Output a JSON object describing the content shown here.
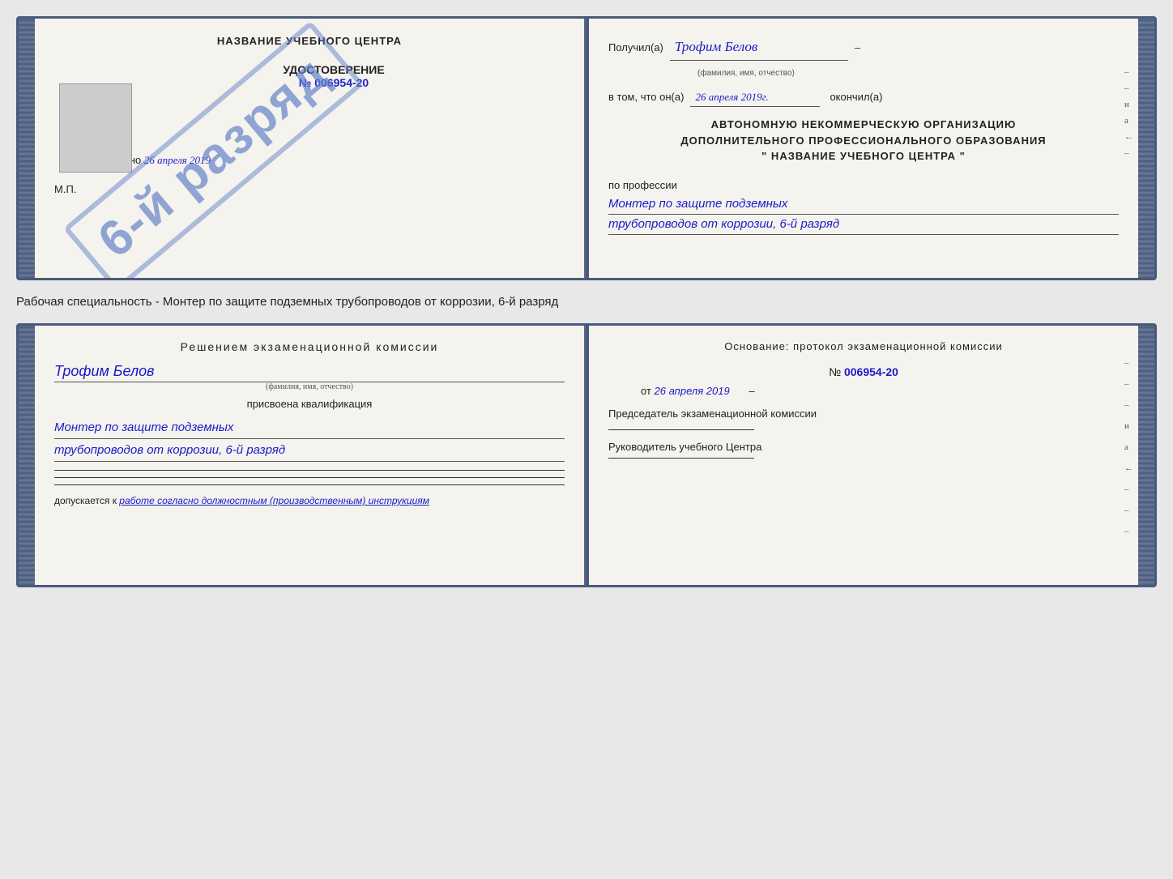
{
  "upper_cert": {
    "left": {
      "header": "НАЗВАНИЕ УЧЕБНОГО ЦЕНТРА",
      "placeholder_box": true,
      "udost_title": "УДОСТОВЕРЕНИЕ",
      "udost_num_prefix": "№",
      "udost_num": "006954-20",
      "vydano_label": "Выдано",
      "vydano_date": "26 апреля 2019",
      "mp_label": "М.П.",
      "stamp_text": "6-й разряд"
    },
    "right": {
      "poluchil_label": "Получил(а)",
      "poluchil_value": "Трофим Белов",
      "poluchil_sub": "(фамилия, имя, отчество)",
      "vtom_label": "в том, что он(а)",
      "vtom_date": "26 апреля 2019г.",
      "okochil_label": "окончил(а)",
      "org_line1": "АВТОНОМНУЮ НЕКОММЕРЧЕСКУЮ ОРГАНИЗАЦИЮ",
      "org_line2": "ДОПОЛНИТЕЛЬНОГО ПРОФЕССИОНАЛЬНОГО ОБРАЗОВАНИЯ",
      "org_name": "\" НАЗВАНИЕ УЧЕБНОГО ЦЕНТРА \"",
      "po_professii": "по профессии",
      "profession_line1": "Монтер по защите подземных",
      "profession_line2": "трубопроводов от коррозии, 6-й разряд",
      "side_marks": [
        "–",
        "–",
        "и",
        "а",
        "←",
        "–"
      ]
    }
  },
  "between_text": "Рабочая специальность - Монтер по защите подземных трубопроводов от коррозии, 6-й разряд",
  "lower_cert": {
    "left": {
      "decision_header": "Решением  экзаменационной  комиссии",
      "person_name": "Трофим Белов",
      "person_sub": "(фамилия, имя, отчество)",
      "assigned_label": "присвоена квалификация",
      "qualification_line1": "Монтер по защите подземных",
      "qualification_line2": "трубопроводов от коррозии, 6-й разряд",
      "допускается_label": "допускается к",
      "допускается_value": "работе согласно должностным (производственным) инструкциям"
    },
    "right": {
      "osnov_label": "Основание:  протокол  экзаменационной  комиссии",
      "num_prefix": "№",
      "num_value": "006954-20",
      "date_prefix": "от",
      "date_value": "26 апреля 2019",
      "commission_label": "Председатель экзаменационной комиссии",
      "rukovoditel_label": "Руководитель учебного Центра",
      "side_marks": [
        "–",
        "–",
        "–",
        "и",
        "а",
        "←",
        "–",
        "–",
        "–"
      ]
    }
  }
}
